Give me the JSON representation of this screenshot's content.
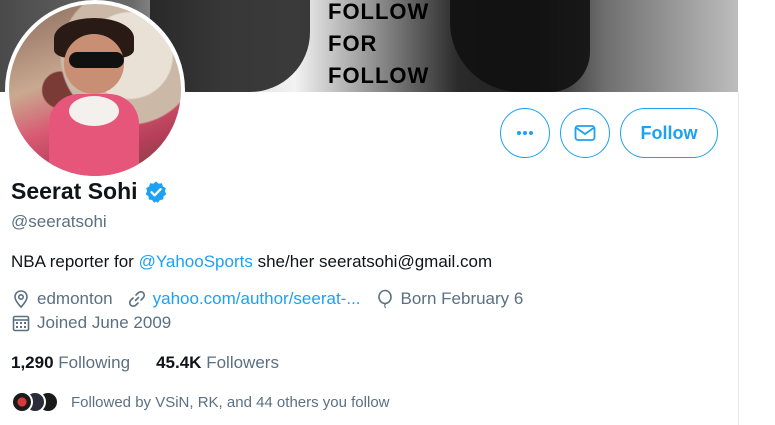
{
  "banner": {
    "text_lines": [
      "FOLLOW",
      "FOR",
      "FOLLOW"
    ]
  },
  "profile": {
    "display_name": "Seerat Sohi",
    "handle": "@seeratsohi",
    "bio_prefix": "NBA reporter for ",
    "bio_mention": "@YahooSports",
    "bio_suffix": " she/her seeratsohi@gmail.com",
    "location": "edmonton",
    "website": "yahoo.com/author/seerat-...",
    "birthday": "Born February 6",
    "joined": "Joined June 2009"
  },
  "actions": {
    "follow_label": "Follow",
    "more_icon": "more-horizontal-icon",
    "message_icon": "mail-icon"
  },
  "stats": {
    "following_count": "1,290",
    "following_label": "Following",
    "followers_count": "45.4K",
    "followers_label": "Followers"
  },
  "followed_by": {
    "text": "Followed by VSiN, RK, and 44 others you follow"
  },
  "colors": {
    "accent": "#1da1f2",
    "secondary_text": "#5b7083",
    "primary_text": "#0f1419"
  }
}
